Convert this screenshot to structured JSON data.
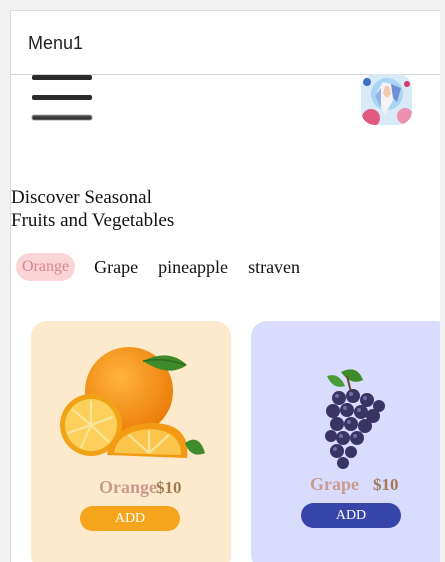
{
  "header": {
    "title": "Menu1"
  },
  "icons": {
    "menu": "hamburger-icon",
    "profile": "avatar-image"
  },
  "headline": {
    "line1": "Discover Seasonal",
    "line2": "Fruits and Vegetables"
  },
  "tabs": [
    {
      "label": "Orange",
      "active": true
    },
    {
      "label": "Grape",
      "active": false
    },
    {
      "label": "pineapple",
      "active": false
    },
    {
      "label": "straven",
      "active": false
    }
  ],
  "cards": [
    {
      "name": "Orange",
      "price": "$10",
      "button": "ADD",
      "background": "#fde9cb",
      "button_color": "#f4a51c"
    },
    {
      "name": "Grape",
      "price": "$10",
      "button": "ADD",
      "background": "#d9dcfd",
      "button_color": "#3546a8"
    }
  ],
  "colors": {
    "active_tab_bg": "#fad4d6",
    "active_tab_text": "#d8868a",
    "name_text": "#c99b8f",
    "price_text": "#a27a52"
  }
}
